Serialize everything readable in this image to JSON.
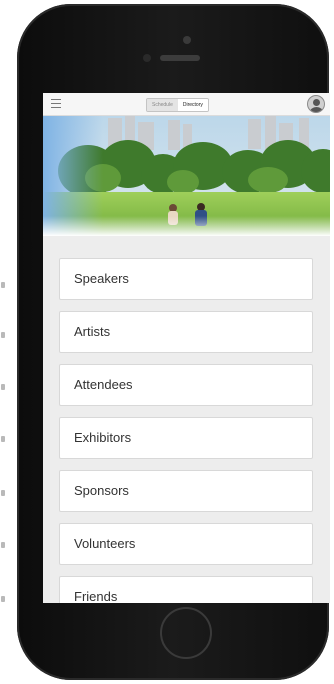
{
  "header": {
    "menu_icon": "hamburger-menu-icon",
    "tabs": [
      {
        "label": "Schedule",
        "active": false
      },
      {
        "label": "Directory",
        "active": true
      }
    ],
    "avatar_icon": "user-avatar-icon"
  },
  "hero": {
    "image": "park-lawn-photo",
    "description_icon": "city-park-scene"
  },
  "directory": {
    "items": [
      {
        "label": "Speakers"
      },
      {
        "label": "Artists"
      },
      {
        "label": "Attendees"
      },
      {
        "label": "Exhibitors"
      },
      {
        "label": "Sponsors"
      },
      {
        "label": "Volunteers"
      },
      {
        "label": "Friends"
      }
    ]
  },
  "colors": {
    "screen_background": "#ededed",
    "card_background": "#ffffff",
    "phone_body": "#111111"
  }
}
